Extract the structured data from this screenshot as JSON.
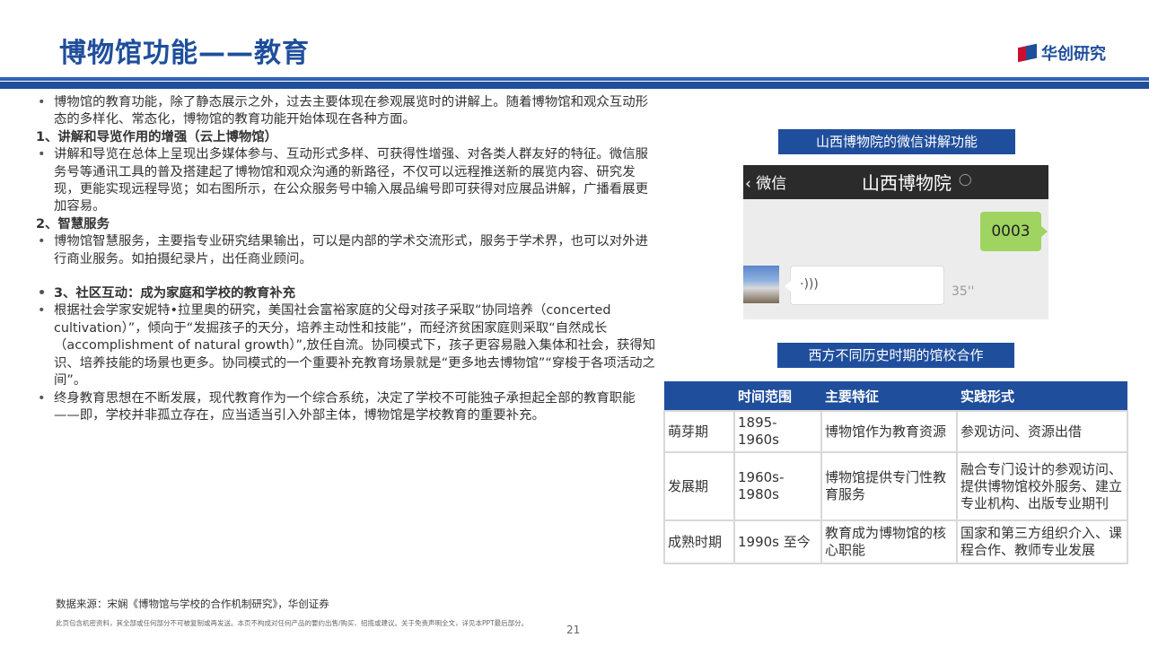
{
  "header": {
    "title": "博物馆功能——教育",
    "logo_text": "华创研究"
  },
  "left": {
    "p1": "博物馆的教育功能，除了静态展示之外，过去主要体现在参观展览时的讲解上。随着博物馆和观众互动形态的多样化、常态化，博物馆的教育功能开始体现在各种方面。",
    "h1": "1、讲解和导览作用的增强（云上博物馆）",
    "p2": "讲解和导览在总体上呈现出多媒体参与、互动形式多样、可获得性增强、对各类人群友好的特征。微信服务号等通讯工具的普及搭建起了博物馆和观众沟通的新路径，不仅可以远程推送新的展览内容、研究发现，更能实现远程导览；如右图所示，在公众服务号中输入展品编号即可获得对应展品讲解，广播看展更加容易。",
    "h2": "2、智慧服务",
    "p3": "博物馆智慧服务，主要指专业研究结果输出，可以是内部的学术交流形式，服务于学术界，也可以对外进行商业服务。如拍摄纪录片，出任商业顾问。",
    "h3": "3、社区互动：成为家庭和学校的教育补充",
    "p4": "根据社会学家安妮特•拉里奥的研究，美国社会富裕家庭的父母对孩子采取“协同培养（concerted cultivation）”，倾向于“发掘孩子的天分，培养主动性和技能”，而经济贫困家庭则采取“自然成长（accomplishment of natural growth）”,放任自流。协同模式下，孩子更容易融入集体和社会，获得知识、培养技能的场景也更多。协同模式的一个重要补充教育场景就是“更多地去博物馆”“穿梭于各项活动之间”。",
    "p5": "终身教育思想在不断发展，现代教育作为一个综合系统，决定了学校不可能独子承担起全部的教育职能——即，学校并非孤立存在，应当适当引入外部主体，博物馆是学校教育的重要补充。"
  },
  "wechat": {
    "caption": "山西博物院的微信讲解功能",
    "back_label": "微信",
    "title": "山西博物院",
    "mic_icon": "microphone-icon",
    "sent_message": "0003",
    "voice_icon": "voice-wave-icon",
    "voice_icon_glyph": "·)))",
    "duration": "35''"
  },
  "table": {
    "caption": "西方不同历史时期的馆校合作",
    "headers": [
      "",
      "时间范围",
      "主要特征",
      "实践形式"
    ],
    "rows": [
      [
        "萌芽期",
        "1895-1960s",
        "博物馆作为教育资源",
        "参观访问、资源出借"
      ],
      [
        "发展期",
        "1960s-1980s",
        "博物馆提供专门性教育服务",
        "融合专门设计的参观访问、提供博物馆校外服务、建立专业机构、出版专业期刊"
      ],
      [
        "成熟时期",
        "1990s 至今",
        "教育成为博物馆的核心职能",
        "国家和第三方组织介入、课程合作、教师专业发展"
      ]
    ]
  },
  "footer": {
    "source": "数据来源：宋娴《博物馆与学校的合作机制研究》，华创证券",
    "disclaimer": "此页包含机密资料，其全部或任何部分不可被复制或再发送。本页不构成对任何产品的要约出售/购买、招揽或建议。关于免责声明全文，详见本PPT最后部分。",
    "page": "21"
  },
  "colors": {
    "brand_blue": "#1f4e9c",
    "logo_red": "#c8102e",
    "bubble_green": "#9fd460"
  }
}
